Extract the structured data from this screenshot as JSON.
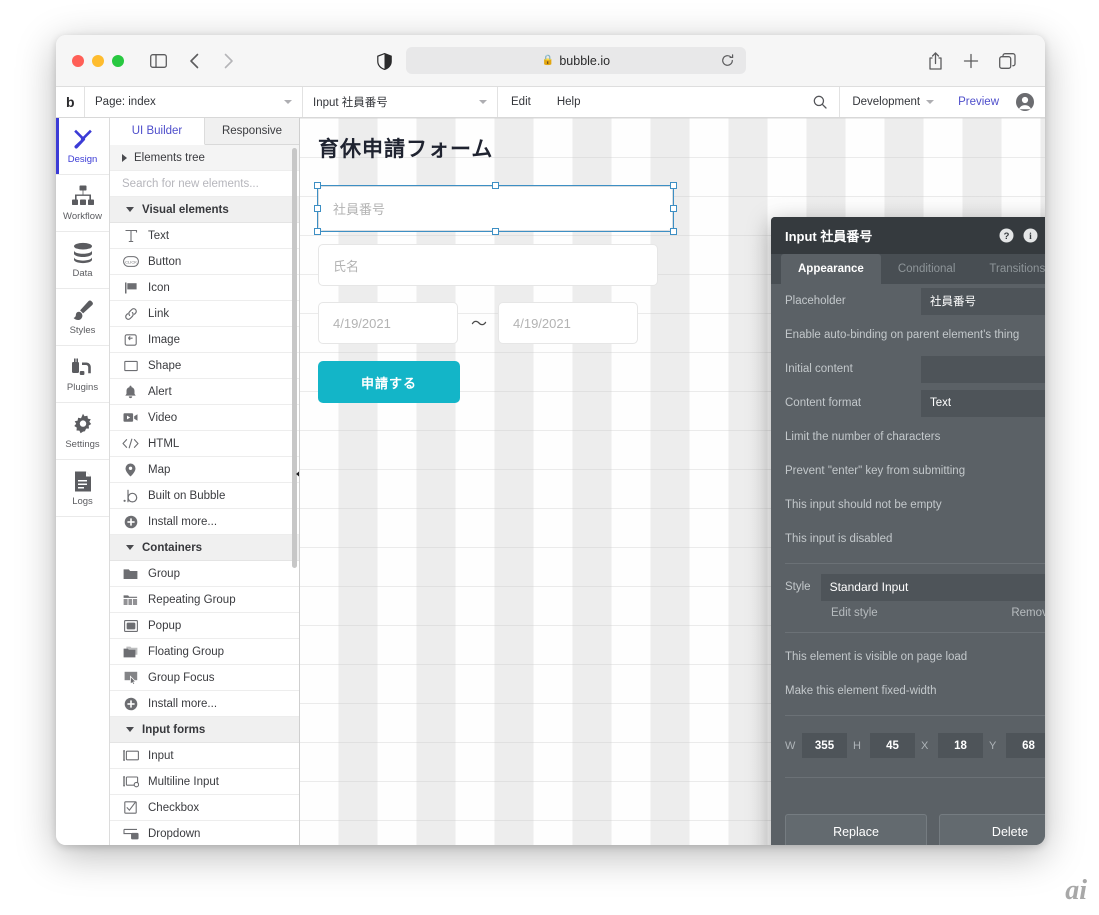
{
  "browser": {
    "url": "bubble.io",
    "lock_icon": "lock-icon",
    "sidebar_icon": "sidebar-toggle-icon",
    "back_icon": "chevron-left-icon",
    "forward_icon": "chevron-right-icon",
    "shield_icon": "privacy-shield-icon",
    "reload_icon": "reload-icon",
    "share_icon": "share-icon",
    "plus_icon": "plus-icon",
    "tabs_icon": "tabs-overview-icon"
  },
  "toolbar": {
    "logo": "b",
    "page_select": "Page: index",
    "element_select": "Input 社員番号",
    "edit": "Edit",
    "help": "Help",
    "search_icon": "search-icon",
    "version": "Development",
    "preview": "Preview",
    "avatar_icon": "user-avatar-icon"
  },
  "rail": {
    "items": [
      {
        "label": "Design",
        "icon": "design-tools-icon",
        "active": true
      },
      {
        "label": "Workflow",
        "icon": "workflow-icon",
        "active": false
      },
      {
        "label": "Data",
        "icon": "database-icon",
        "active": false
      },
      {
        "label": "Styles",
        "icon": "paintbrush-icon",
        "active": false
      },
      {
        "label": "Plugins",
        "icon": "plugins-icon",
        "active": false
      },
      {
        "label": "Settings",
        "icon": "gear-icon",
        "active": false
      },
      {
        "label": "Logs",
        "icon": "document-logs-icon",
        "active": false
      }
    ]
  },
  "elements_panel": {
    "tabs": [
      {
        "label": "UI Builder",
        "active": true
      },
      {
        "label": "Responsive",
        "active": false
      }
    ],
    "elements_tree": "Elements tree",
    "search_placeholder": "Search for new elements...",
    "sections": [
      {
        "title": "Visual elements",
        "items": [
          {
            "label": "Text",
            "icon": "text-icon"
          },
          {
            "label": "Button",
            "icon": "button-icon"
          },
          {
            "label": "Icon",
            "icon": "flag-icon"
          },
          {
            "label": "Link",
            "icon": "link-icon"
          },
          {
            "label": "Image",
            "icon": "image-icon"
          },
          {
            "label": "Shape",
            "icon": "shape-rectangle-icon"
          },
          {
            "label": "Alert",
            "icon": "bell-icon"
          },
          {
            "label": "Video",
            "icon": "video-icon"
          },
          {
            "label": "HTML",
            "icon": "code-icon"
          },
          {
            "label": "Map",
            "icon": "map-pin-icon"
          },
          {
            "label": "Built on Bubble",
            "icon": "bubble-logo-icon"
          },
          {
            "label": "Install more...",
            "icon": "plus-circle-icon"
          }
        ]
      },
      {
        "title": "Containers",
        "items": [
          {
            "label": "Group",
            "icon": "folder-icon"
          },
          {
            "label": "Repeating Group",
            "icon": "repeating-folder-icon"
          },
          {
            "label": "Popup",
            "icon": "popup-icon"
          },
          {
            "label": "Floating Group",
            "icon": "floating-group-icon"
          },
          {
            "label": "Group Focus",
            "icon": "group-focus-icon"
          },
          {
            "label": "Install more...",
            "icon": "plus-circle-icon"
          }
        ]
      },
      {
        "title": "Input forms",
        "items": [
          {
            "label": "Input",
            "icon": "input-icon"
          },
          {
            "label": "Multiline Input",
            "icon": "multiline-input-icon"
          },
          {
            "label": "Checkbox",
            "icon": "checkbox-icon"
          },
          {
            "label": "Dropdown",
            "icon": "dropdown-icon"
          }
        ]
      }
    ],
    "collapse_icon": "collapse-panel-icon"
  },
  "canvas": {
    "title": "育休申請フォーム",
    "employee_placeholder": "社員番号",
    "name_placeholder": "氏名",
    "date_from": "4/19/2021",
    "date_to": "4/19/2021",
    "date_separator": "～",
    "submit_label": "申請する",
    "accent_color": "#13b5c8",
    "selection_color": "#3d8fc4"
  },
  "property_panel": {
    "title": "Input 社員番号",
    "header_icons": [
      {
        "name": "help-icon"
      },
      {
        "name": "info-icon"
      },
      {
        "name": "comment-icon"
      },
      {
        "name": "close-icon"
      }
    ],
    "tabs": [
      {
        "label": "Appearance",
        "active": true
      },
      {
        "label": "Conditional",
        "active": false
      },
      {
        "label": "Transitions",
        "active": false
      }
    ],
    "fields": {
      "placeholder_label": "Placeholder",
      "placeholder_value": "社員番号",
      "autobinding_label": "Enable auto-binding on parent element's thing",
      "autobinding_checked": false,
      "initial_content_label": "Initial content",
      "initial_content_value": "",
      "content_format_label": "Content format",
      "content_format_value": "Text",
      "limit_chars_label": "Limit the number of characters",
      "limit_chars_checked": false,
      "prevent_enter_label": "Prevent \"enter\" key from submitting",
      "prevent_enter_checked": false,
      "not_empty_label": "This input should not be empty",
      "not_empty_checked": false,
      "disabled_label": "This input is disabled",
      "disabled_checked": false,
      "style_label": "Style",
      "style_value": "Standard Input",
      "edit_style": "Edit style",
      "remove_style": "Remove style",
      "visible_label": "This element is visible on page load",
      "visible_checked": true,
      "fixed_width_label": "Make this element fixed-width",
      "fixed_width_checked": true
    },
    "dimensions": {
      "w_label": "W",
      "w_value": "355",
      "h_label": "H",
      "h_value": "45",
      "x_label": "X",
      "x_value": "18",
      "y_label": "Y",
      "y_value": "68"
    },
    "replace_button": "Replace",
    "delete_button": "Delete"
  },
  "watermark": "ai"
}
